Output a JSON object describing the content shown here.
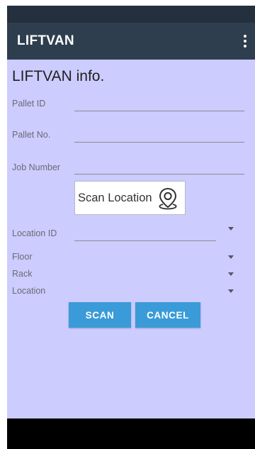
{
  "app": {
    "title": "LIFTVAN"
  },
  "page": {
    "title": "LIFTVAN info."
  },
  "form": {
    "pallet_id_label": "Pallet ID",
    "pallet_no_label": "Pallet No.",
    "job_number_label": "Job Number",
    "scan_location_label": "Scan Location",
    "location_id_label": "Location ID",
    "floor_label": "Floor",
    "rack_label": "Rack",
    "location_label": "Location"
  },
  "buttons": {
    "scan": "SCAN",
    "cancel": "CANCEL"
  },
  "colors": {
    "background": "#ccccff",
    "app_bar": "#2e3e4f",
    "status_bar": "#24303e",
    "button": "#3a9bd8"
  },
  "icons": {
    "menu": "overflow-menu-icon",
    "scan_location": "location-pin-icon",
    "dropdown": "dropdown-arrow-icon"
  }
}
